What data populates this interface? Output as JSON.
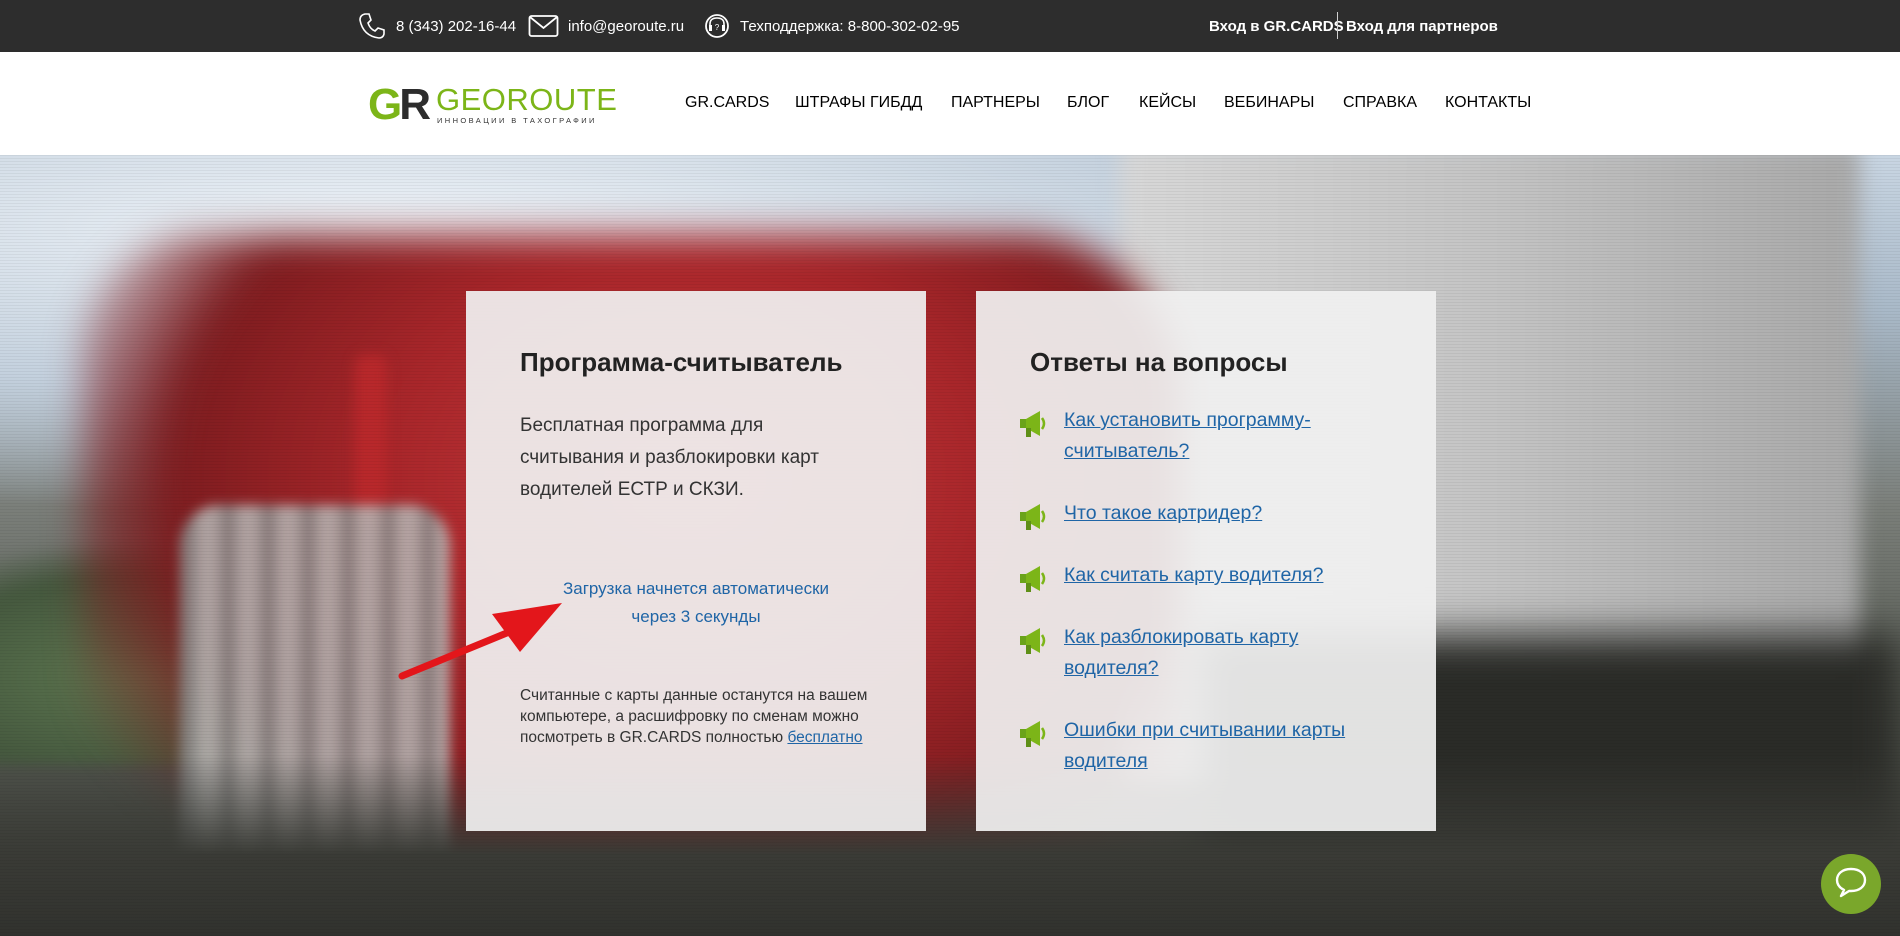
{
  "topbar": {
    "phone": "8 (343) 202-16-44",
    "email": "info@georoute.ru",
    "support": "Техподдержка: 8-800-302-02-95",
    "login_grcards": "Вход в GR.CARDS",
    "login_partners": "Вход для партнеров"
  },
  "logo": {
    "mark_g": "G",
    "mark_r": "R",
    "name": "GEOROUTE",
    "tagline": "ИННОВАЦИИ В ТАХОГРАФИИ"
  },
  "nav": [
    "GR.CARDS",
    "ШТРАФЫ ГИБДД",
    "ПАРТНЕРЫ",
    "БЛОГ",
    "КЕЙСЫ",
    "ВЕБИНАРЫ",
    "СПРАВКА",
    "КОНТАКТЫ"
  ],
  "reader_card": {
    "title": "Программа-считыватель",
    "description": "Бесплатная программа для считывания и разблокировки карт водителей ЕСТР и СКЗИ.",
    "loading_line1": "Загрузка начнется автоматически",
    "loading_line2": "через 3 секунды",
    "note_text": "Считанные с карты данные останутся на вашем компьютере, а расшифровку по сменам можно посмотреть в GR.CARDS полностью",
    "note_link": "бесплатно"
  },
  "faq_card": {
    "title": "Ответы на вопросы",
    "items": [
      "Как установить программу-считыватель?",
      "Что такое картридер?",
      "Как считать карту водителя?",
      "Как разблокировать карту водителя?",
      "Ошибки при считывании карты водителя"
    ]
  },
  "colors": {
    "brand_green": "#7cb518",
    "link_blue": "#1f65a6",
    "topbar_bg": "#2d2d2d",
    "arrow_red": "#e3161b",
    "chat_green": "#7aa72b"
  }
}
